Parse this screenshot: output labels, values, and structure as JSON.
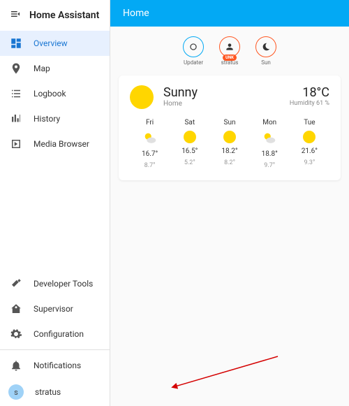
{
  "app_title": "Home Assistant",
  "sidebar": {
    "nav": [
      {
        "id": "overview",
        "label": "Overview",
        "active": true
      },
      {
        "id": "map",
        "label": "Map"
      },
      {
        "id": "logbook",
        "label": "Logbook"
      },
      {
        "id": "history",
        "label": "History"
      },
      {
        "id": "media",
        "label": "Media Browser"
      }
    ],
    "tools": [
      {
        "id": "devtools",
        "label": "Developer Tools"
      },
      {
        "id": "supervisor",
        "label": "Supervisor"
      },
      {
        "id": "config",
        "label": "Configuration"
      }
    ],
    "notifications_label": "Notifications",
    "user": {
      "initial": "s",
      "name": "stratus"
    }
  },
  "header": {
    "title": "Home"
  },
  "badges": [
    {
      "id": "updater",
      "label": "Updater",
      "color": "#03a9f4",
      "pill": ""
    },
    {
      "id": "stratus",
      "label": "stratus",
      "color": "#ff5722",
      "pill": "UNK"
    },
    {
      "id": "sun",
      "label": "Sun",
      "color": "#ff5722",
      "pill": ""
    }
  ],
  "weather": {
    "condition": "Sunny",
    "location": "Home",
    "temp": "18°C",
    "humidity": "Humidity 61 %",
    "forecast": [
      {
        "day": "Fri",
        "icon": "partly",
        "hi": "16.7°",
        "lo": "8.7°"
      },
      {
        "day": "Sat",
        "icon": "sunny",
        "hi": "16.5°",
        "lo": "5.2°"
      },
      {
        "day": "Sun",
        "icon": "sunny",
        "hi": "18.2°",
        "lo": "8.2°"
      },
      {
        "day": "Mon",
        "icon": "partly",
        "hi": "18.8°",
        "lo": "9.7°"
      },
      {
        "day": "Tue",
        "icon": "sunny",
        "hi": "21.6°",
        "lo": "9.3°"
      }
    ]
  }
}
